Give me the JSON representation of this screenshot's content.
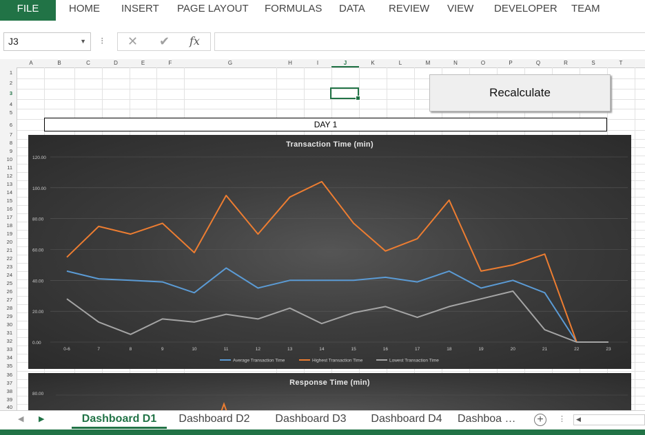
{
  "ribbon": {
    "file": "FILE",
    "tabs": [
      "HOME",
      "INSERT",
      "PAGE LAYOUT",
      "FORMULAS",
      "DATA",
      "REVIEW",
      "VIEW",
      "DEVELOPER",
      "TEAM"
    ]
  },
  "formula_bar": {
    "name_box": "J3",
    "formula": "",
    "icons": [
      "cancel-icon",
      "enter-icon",
      "insert-function-icon"
    ]
  },
  "columns": [
    "A",
    "B",
    "C",
    "D",
    "E",
    "F",
    "G",
    "H",
    "I",
    "J",
    "K",
    "L",
    "M",
    "N",
    "O",
    "P",
    "Q",
    "R",
    "S",
    "T"
  ],
  "selected_column": "J",
  "rows": [
    "1",
    "2",
    "3",
    "4",
    "5",
    "6",
    "7",
    "8",
    "9",
    "10",
    "11",
    "12",
    "13",
    "14",
    "15",
    "16",
    "17",
    "18",
    "19",
    "20",
    "21",
    "22",
    "23",
    "24",
    "25",
    "26",
    "27",
    "28",
    "29",
    "30",
    "31",
    "32",
    "33",
    "34",
    "35",
    "36",
    "37",
    "38",
    "39",
    "40"
  ],
  "selected_row": "3",
  "recalculate_button": "Recalculate",
  "day_label": "DAY 1",
  "colors": {
    "accent": "#217346",
    "average": "#5b9bd5",
    "highest": "#ed7d31",
    "lowest": "#a5a5a5"
  },
  "chart_data": [
    {
      "type": "line",
      "title": "Transaction Time (min)",
      "xlabel": "",
      "ylabel": "",
      "categories": [
        "0-6",
        "7",
        "8",
        "9",
        "10",
        "11",
        "12",
        "13",
        "14",
        "15",
        "16",
        "17",
        "18",
        "19",
        "20",
        "21",
        "22",
        "23"
      ],
      "ylim": [
        0,
        120
      ],
      "yticks": [
        "0.00",
        "20.00",
        "40.00",
        "60.00",
        "80.00",
        "100.00",
        "120.00"
      ],
      "legend_position": "bottom",
      "grid": true,
      "series": [
        {
          "name": "Average Transaction Time",
          "values": [
            46,
            41,
            40,
            39,
            32,
            48,
            35,
            40,
            40,
            40,
            42,
            39,
            46,
            35,
            40,
            32,
            0,
            null
          ]
        },
        {
          "name": "Highest Transaction Time",
          "values": [
            55,
            75,
            70,
            77,
            58,
            95,
            70,
            94,
            104,
            77,
            59,
            67,
            92,
            46,
            50,
            57,
            0,
            null
          ]
        },
        {
          "name": "Lowest Transaction Time",
          "values": [
            28,
            13,
            5,
            15,
            13,
            18,
            15,
            22,
            12,
            19,
            23,
            16,
            23,
            28,
            33,
            8,
            0,
            0
          ]
        }
      ]
    },
    {
      "type": "line",
      "title": "Response Time (min)",
      "yticks": [
        "80.00"
      ],
      "categories": [],
      "series": []
    }
  ],
  "sheet_tabs": [
    "Dashboard D1",
    "Dashboard D2",
    "Dashboard D3",
    "Dashboard D4",
    "Dashboa …"
  ],
  "active_sheet": "Dashboard D1"
}
